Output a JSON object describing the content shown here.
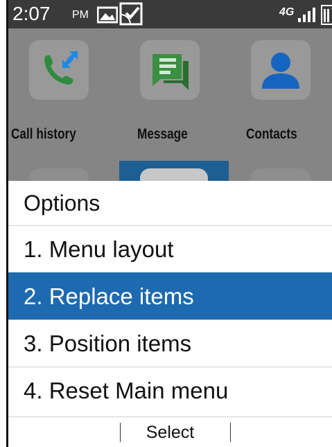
{
  "status_bar": {
    "time": "2:07",
    "ampm": "PM",
    "network_label": "4G"
  },
  "home": {
    "apps": [
      {
        "label": "Call history",
        "icon": "call-history-icon"
      },
      {
        "label": "Message",
        "icon": "message-icon"
      },
      {
        "label": "Contacts",
        "icon": "contacts-icon"
      }
    ]
  },
  "options": {
    "title": "Options",
    "items": [
      {
        "label": "1. Menu layout",
        "selected": false
      },
      {
        "label": "2. Replace items",
        "selected": true
      },
      {
        "label": "3. Position items",
        "selected": false
      },
      {
        "label": "4. Reset Main menu",
        "selected": false
      }
    ]
  },
  "softkeys": {
    "left": "",
    "center": "Select",
    "right": ""
  },
  "colors": {
    "selection": "#1d6ab0",
    "status_bar": "#3a3a3a",
    "call_green": "#2e7d32",
    "contacts_blue": "#1565c0"
  }
}
